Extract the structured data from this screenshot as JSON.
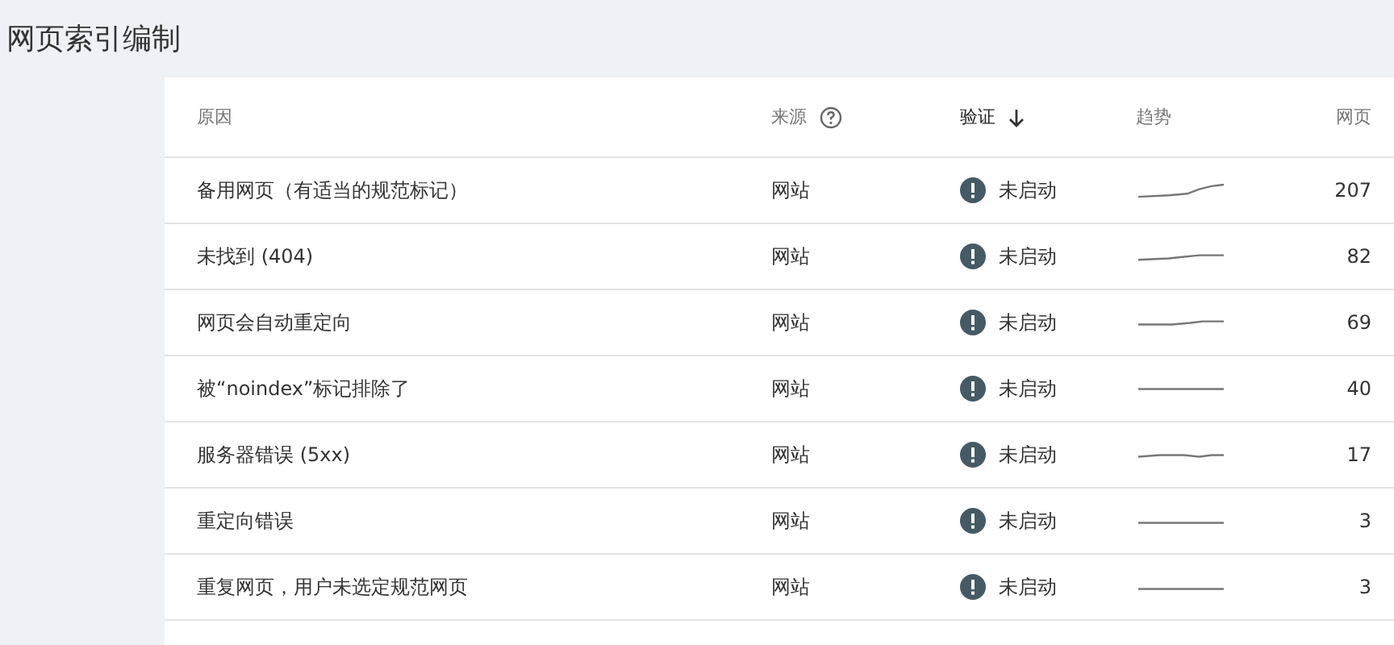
{
  "page_title": "网页索引编制",
  "table": {
    "columns": [
      {
        "label": "原因",
        "help": false,
        "sorted": false
      },
      {
        "label": "来源",
        "help": true,
        "sorted": false
      },
      {
        "label": "验证",
        "help": false,
        "sorted": true
      },
      {
        "label": "趋势",
        "help": false,
        "sorted": false
      },
      {
        "label": "网页",
        "help": false,
        "sorted": false
      }
    ],
    "rows": [
      {
        "reason": "备用网页（有适当的规范标记）",
        "source": "网站",
        "status": "未启动",
        "pages": "207"
      },
      {
        "reason": "未找到 (404)",
        "source": "网站",
        "status": "未启动",
        "pages": "82"
      },
      {
        "reason": "网页会自动重定向",
        "source": "网站",
        "status": "未启动",
        "pages": "69"
      },
      {
        "reason": "被“noindex”标记排除了",
        "source": "网站",
        "status": "未启动",
        "pages": "40"
      },
      {
        "reason": "服务器错误 (5xx)",
        "source": "网站",
        "status": "未启动",
        "pages": "17"
      },
      {
        "reason": "重定向错误",
        "source": "网站",
        "status": "未启动",
        "pages": "3"
      },
      {
        "reason": "重复网页，用户未选定规范网页",
        "source": "网站",
        "status": "未启动",
        "pages": "3"
      }
    ]
  }
}
